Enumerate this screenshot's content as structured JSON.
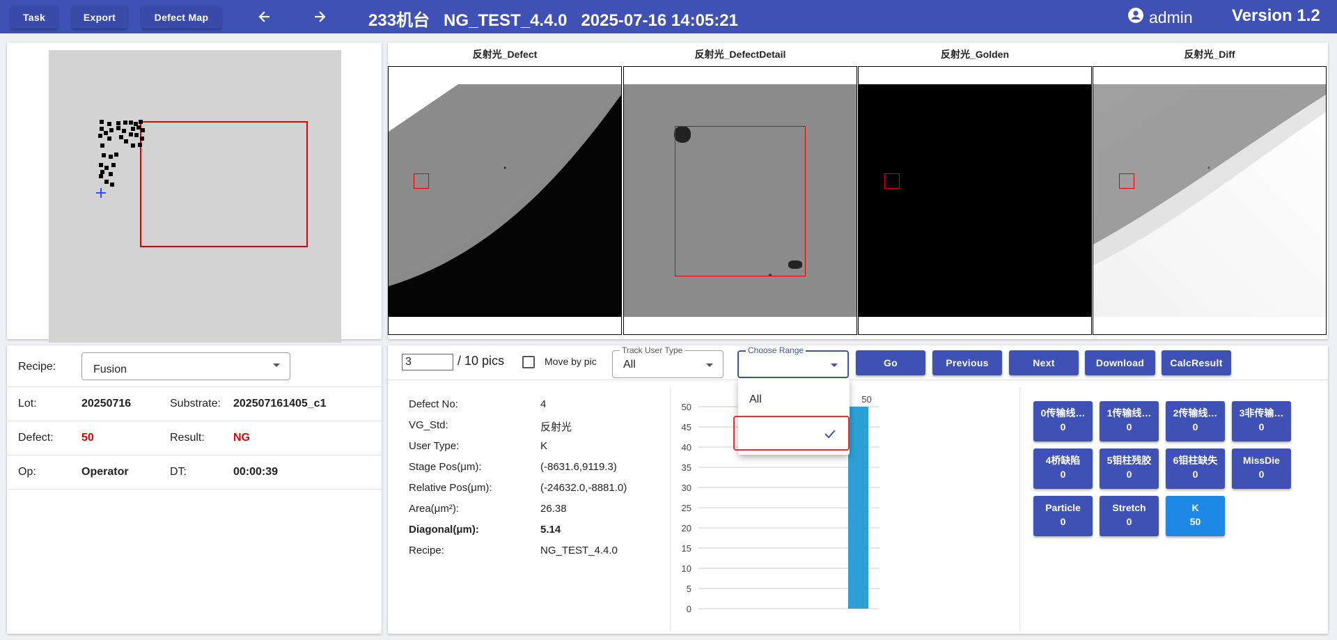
{
  "header": {
    "task_label": "Task",
    "export_label": "Export",
    "defect_map_label": "Defect Map",
    "title": "233机台   NG_TEST_4.4.0   2025-07-16 14:05:21",
    "user": "admin",
    "version": "Version 1.2"
  },
  "images": [
    {
      "title": "反射光_Defect"
    },
    {
      "title": "反射光_DefectDetail"
    },
    {
      "title": "反射光_Golden"
    },
    {
      "title": "反射光_Diff"
    }
  ],
  "info": {
    "recipe_label": "Recipe:",
    "recipe_value": "Fusion",
    "lot_label": "Lot:",
    "lot_value": "20250716",
    "substrate_label": "Substrate:",
    "substrate_value": "202507161405_c1",
    "defect_label": "Defect:",
    "defect_value": "50",
    "result_label": "Result:",
    "result_value": "NG",
    "op_label": "Op:",
    "op_value": "Operator",
    "dt_label": "DT:",
    "dt_value": "00:00:39"
  },
  "toolbar": {
    "page_value": "3",
    "page_total": "/ 10 pics",
    "move_by_pic": "Move by pic",
    "track_user_type_label": "Track User Type",
    "track_user_type_value": "All",
    "choose_range_label": "Choose Range",
    "go": "Go",
    "previous": "Previous",
    "next": "Next",
    "download": "Download",
    "calc_result": "CalcResult"
  },
  "dropdown": {
    "options": [
      "All",
      ""
    ]
  },
  "details": [
    {
      "key": "Defect No:",
      "value": "4",
      "bold": false
    },
    {
      "key": "VG_Std:",
      "value": "反射光",
      "bold": false
    },
    {
      "key": "User Type:",
      "value": "K",
      "bold": false
    },
    {
      "key": "Stage Pos(μm):",
      "value": "(-8631.6,9119.3)",
      "bold": false
    },
    {
      "key": "Relative Pos(μm):",
      "value": "(-24632.0,-8881.0)",
      "bold": false
    },
    {
      "key": "Area(μm²):",
      "value": "26.38",
      "bold": false
    },
    {
      "key": "Diagonal(μm):",
      "value": "5.14",
      "bold": true
    },
    {
      "key": "Recipe:",
      "value": "NG_TEST_4.4.0",
      "bold": false
    }
  ],
  "chart_data": {
    "type": "bar",
    "categories": [
      ""
    ],
    "values": [
      50
    ],
    "data_labels": [
      "50"
    ],
    "ylim": [
      0,
      50
    ],
    "yticks": [
      "0",
      "5",
      "10",
      "15",
      "20",
      "25",
      "30",
      "35",
      "40",
      "45",
      "50"
    ],
    "bar_color": "#2ca0d6",
    "grid": true
  },
  "categories": [
    {
      "name": "0传输线…",
      "count": "0",
      "active": false
    },
    {
      "name": "1传输线…",
      "count": "0",
      "active": false
    },
    {
      "name": "2传输线…",
      "count": "0",
      "active": false
    },
    {
      "name": "3非传输…",
      "count": "0",
      "active": false
    },
    {
      "name": "4桥缺陷",
      "count": "0",
      "active": false
    },
    {
      "name": "5钼柱残胶",
      "count": "0",
      "active": false
    },
    {
      "name": "6钼柱缺失",
      "count": "0",
      "active": false
    },
    {
      "name": "MissDie",
      "count": "0",
      "active": false
    },
    {
      "name": "Particle",
      "count": "0",
      "active": false
    },
    {
      "name": "Stretch",
      "count": "0",
      "active": false
    },
    {
      "name": "K",
      "count": "50",
      "active": true
    }
  ],
  "colors": {
    "primary": "#3f51b5",
    "active": "#1e88e5",
    "alert": "#e00000"
  }
}
